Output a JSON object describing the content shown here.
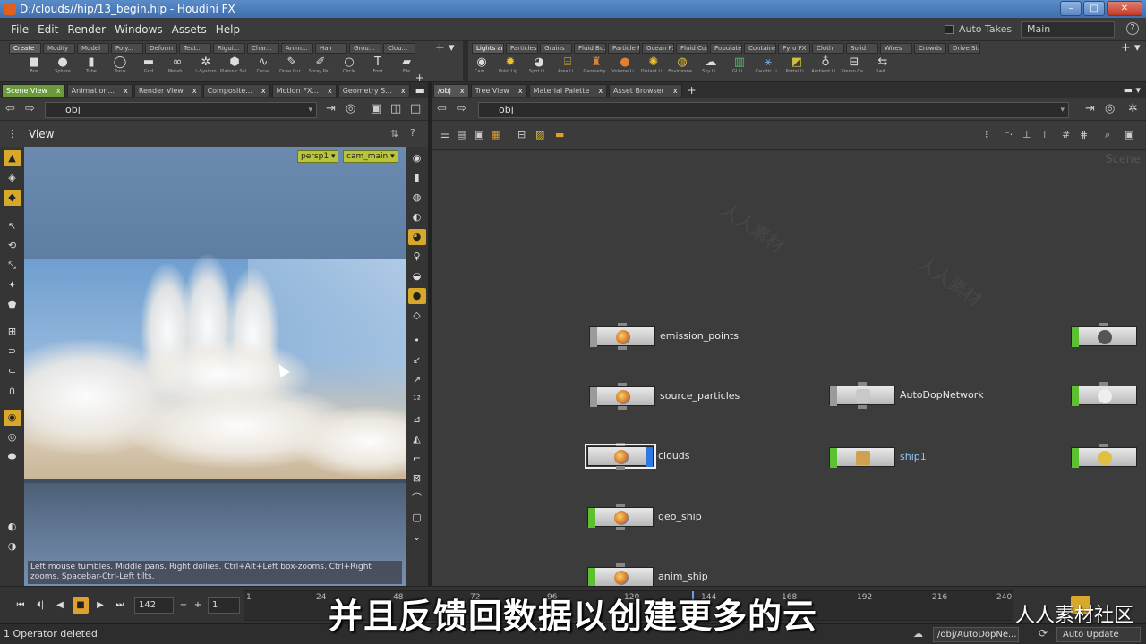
{
  "window": {
    "title": "D:/clouds//hip/13_begin.hip - Houdini FX",
    "buttons": [
      "–",
      "□",
      "✕"
    ]
  },
  "menubar": {
    "items": [
      "File",
      "Edit",
      "Render",
      "Windows",
      "Assets",
      "Help"
    ],
    "auto_takes": "Auto Takes",
    "take": "Main"
  },
  "shelf_left": {
    "tabs": [
      "Create",
      "Modify",
      "Model",
      "Poly...",
      "Deform",
      "Text...",
      "Rigui...",
      "Char...",
      "Anim...",
      "Hair",
      "Grou...",
      "Clou..."
    ],
    "tools": [
      "Box",
      "Sphere",
      "Tube",
      "Torus",
      "Grid",
      "Metab...",
      "L-System",
      "Platonic Sol...",
      "Curve",
      "Draw Cur...",
      "Spray Pa...",
      "Circle",
      "Font",
      "File"
    ]
  },
  "shelf_right": {
    "tabs": [
      "Lights an...",
      "Particles",
      "Grains",
      "Fluid Bu...",
      "Particle F...",
      "Ocean FX",
      "Fluid Co...",
      "Populate...",
      "Containe...",
      "Pyro FX",
      "Cloth",
      "Solid",
      "Wires",
      "Crowds",
      "Drive Si..."
    ],
    "tools": [
      "Cam...",
      "Point Lig...",
      "Spot Li...",
      "Area Li...",
      "Geometry...",
      "Volume Li...",
      "Distant Li...",
      "Environme...",
      "Sky Li...",
      "GI Li...",
      "Caustic Li...",
      "Portal Li...",
      "Ambient Li...",
      "Stereo Ca...",
      "Swit..."
    ]
  },
  "left_pane": {
    "tabs": [
      "Scene View",
      "Animation...",
      "Render View",
      "Composite...",
      "Motion FX...",
      "Geometry S..."
    ],
    "path": "obj",
    "view_label": "View",
    "camera_menus": [
      "persp1",
      "cam_main"
    ],
    "hint": "Left mouse tumbles. Middle pans. Right dollies. Ctrl+Alt+Left box-zooms. Ctrl+Right zooms. Spacebar-Ctrl-Left tilts."
  },
  "right_pane": {
    "tabs": [
      "/obj",
      "Tree View",
      "Material Palette",
      "Asset Browser"
    ],
    "path": "obj",
    "scene_label": "Scene",
    "nodes": [
      {
        "name": "emission_points",
        "flag": "gray"
      },
      {
        "name": "source_particles",
        "flag": "gray"
      },
      {
        "name": "clouds",
        "flag": "blue"
      },
      {
        "name": "geo_ship",
        "flag": "green"
      },
      {
        "name": "anim_ship",
        "flag": "green"
      },
      {
        "name": "AutoDopNetwork",
        "flag": "gray"
      },
      {
        "name": "ship1",
        "flag": "green"
      }
    ]
  },
  "timeline": {
    "frame": "142",
    "step": "1",
    "ticks": [
      "1",
      "24",
      "48",
      "72",
      "96",
      "120",
      "144",
      "168",
      "192",
      "216",
      "240"
    ]
  },
  "statusbar": {
    "message": "1 Operator deleted",
    "network_path": "/obj/AutoDopNe...",
    "update_mode": "Auto Update"
  },
  "subtitle": "并且反馈回数据以创建更多的云",
  "brand": "人人素材社区",
  "colors": {
    "accent_green": "#6a9a3a",
    "selected_yellow": "#d8a82a",
    "node_blue": "#2a7ae2"
  }
}
